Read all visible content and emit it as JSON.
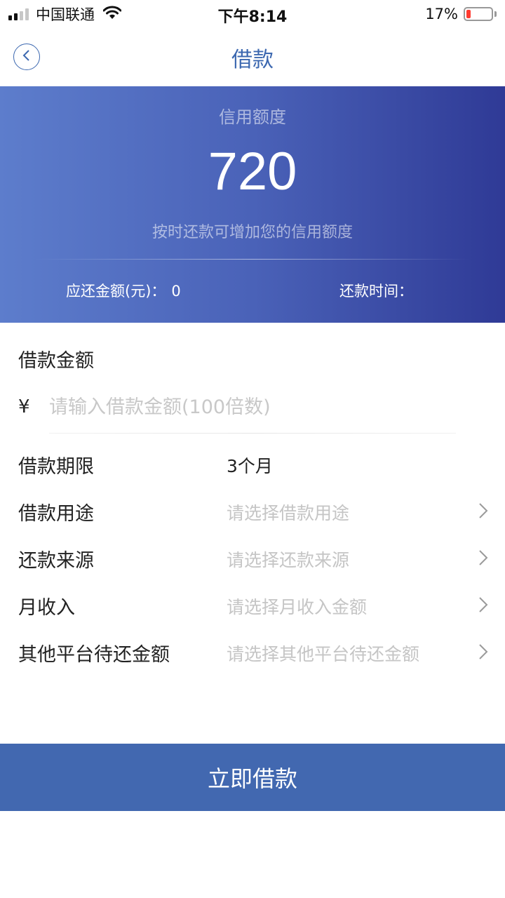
{
  "status_bar": {
    "carrier": "中国联通",
    "time": "下午8:14",
    "battery_percent": "17%",
    "battery_level": 0.17,
    "signal_bars": 2
  },
  "nav": {
    "title": "借款",
    "back_icon": "chevron-left-icon"
  },
  "credit": {
    "label": "信用额度",
    "value": "720",
    "tip": "按时还款可增加您的信用额度",
    "due_label": "应还金额(元)：",
    "due_value": "0",
    "repay_time_label": "还款时间："
  },
  "amount": {
    "title": "借款金额",
    "currency": "¥",
    "placeholder": "请输入借款金额(100倍数)",
    "value": ""
  },
  "form": {
    "term": {
      "label": "借款期限",
      "value": "3个月"
    },
    "purpose": {
      "label": "借款用途",
      "placeholder": "请选择借款用途"
    },
    "source": {
      "label": "还款来源",
      "placeholder": "请选择还款来源"
    },
    "income": {
      "label": "月收入",
      "placeholder": "请选择月收入金额"
    },
    "other_debt": {
      "label": "其他平台待还金额",
      "placeholder": "请选择其他平台待还金额"
    }
  },
  "submit": {
    "label": "立即借款"
  },
  "colors": {
    "accent": "#4268b0",
    "banner_start": "#5d7dcc",
    "banner_end": "#2f3a96",
    "battery_low": "#ff3b30"
  }
}
